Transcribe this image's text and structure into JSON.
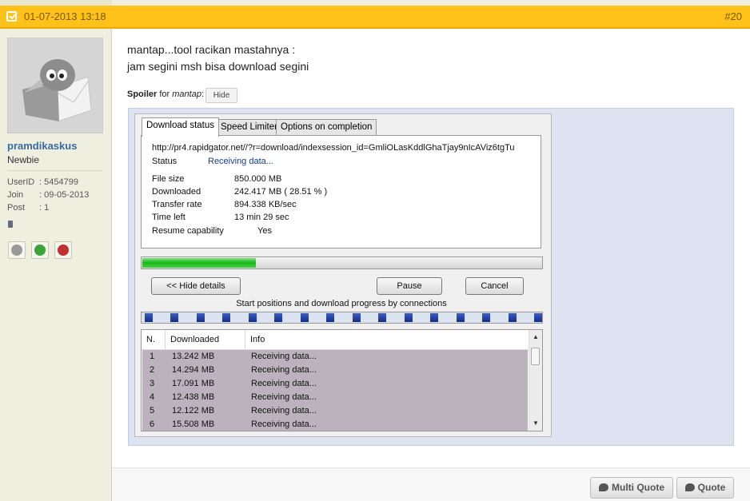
{
  "post": {
    "date": "01-07-2013 13:18",
    "number": "#20"
  },
  "user": {
    "name": "pramdikaskus",
    "rank": "Newbie",
    "info": [
      {
        "key": "UserID",
        "value": ": 5454799"
      },
      {
        "key": "Join",
        "value": ": 09-05-2013"
      },
      {
        "key": "Post",
        "value": ": 1"
      }
    ]
  },
  "message": {
    "line1": "mantap...tool racikan mastahnya :",
    "line2": "jam segini msh bisa download segini"
  },
  "spoiler": {
    "label": "Spoiler",
    "for_text": " for ",
    "title": "mantap",
    "colon": ":",
    "hide_label": "Hide"
  },
  "download_window": {
    "tabs": [
      "Download status",
      "Speed Limiter",
      "Options on completion"
    ],
    "url": "http://pr4.rapidgator.net//?r=download/indexsession_id=GmliOLasKddlGhaTjay9nIcAViz6tgTu",
    "status_label": "Status",
    "status_value": "Receiving data...",
    "fields": [
      {
        "label": "File size",
        "value": "850.000  MB"
      },
      {
        "label": "Downloaded",
        "value": "242.417  MB  ( 28.51 % )"
      },
      {
        "label": "Transfer rate",
        "value": "894.338  KB/sec"
      },
      {
        "label": "Time left",
        "value": "13 min 29 sec"
      }
    ],
    "resume_label": "Resume capability",
    "resume_value": "Yes",
    "progress_fraction": 0.2851,
    "buttons": {
      "hide_details": "<< Hide details",
      "pause": "Pause",
      "cancel": "Cancel"
    },
    "connections_caption": "Start positions and download progress by connections",
    "connection_segments": 16,
    "table": {
      "columns": [
        "N.",
        "Downloaded",
        "Info"
      ],
      "rows": [
        {
          "n": "1",
          "downloaded": "13.242  MB",
          "info": "Receiving data..."
        },
        {
          "n": "2",
          "downloaded": "14.294  MB",
          "info": "Receiving data..."
        },
        {
          "n": "3",
          "downloaded": "17.091  MB",
          "info": "Receiving data..."
        },
        {
          "n": "4",
          "downloaded": "12.438  MB",
          "info": "Receiving data..."
        },
        {
          "n": "5",
          "downloaded": "12.122  MB",
          "info": "Receiving data..."
        },
        {
          "n": "6",
          "downloaded": "15.508  MB",
          "info": "Receiving data..."
        }
      ]
    }
  },
  "footer": {
    "multi_quote": "Multi Quote",
    "quote": "Quote"
  },
  "colors": {
    "header_bar": "#ffc21a",
    "username": "#3a6aa0",
    "progress_green": "#19b619",
    "table_rows": "#bcb2bd"
  }
}
